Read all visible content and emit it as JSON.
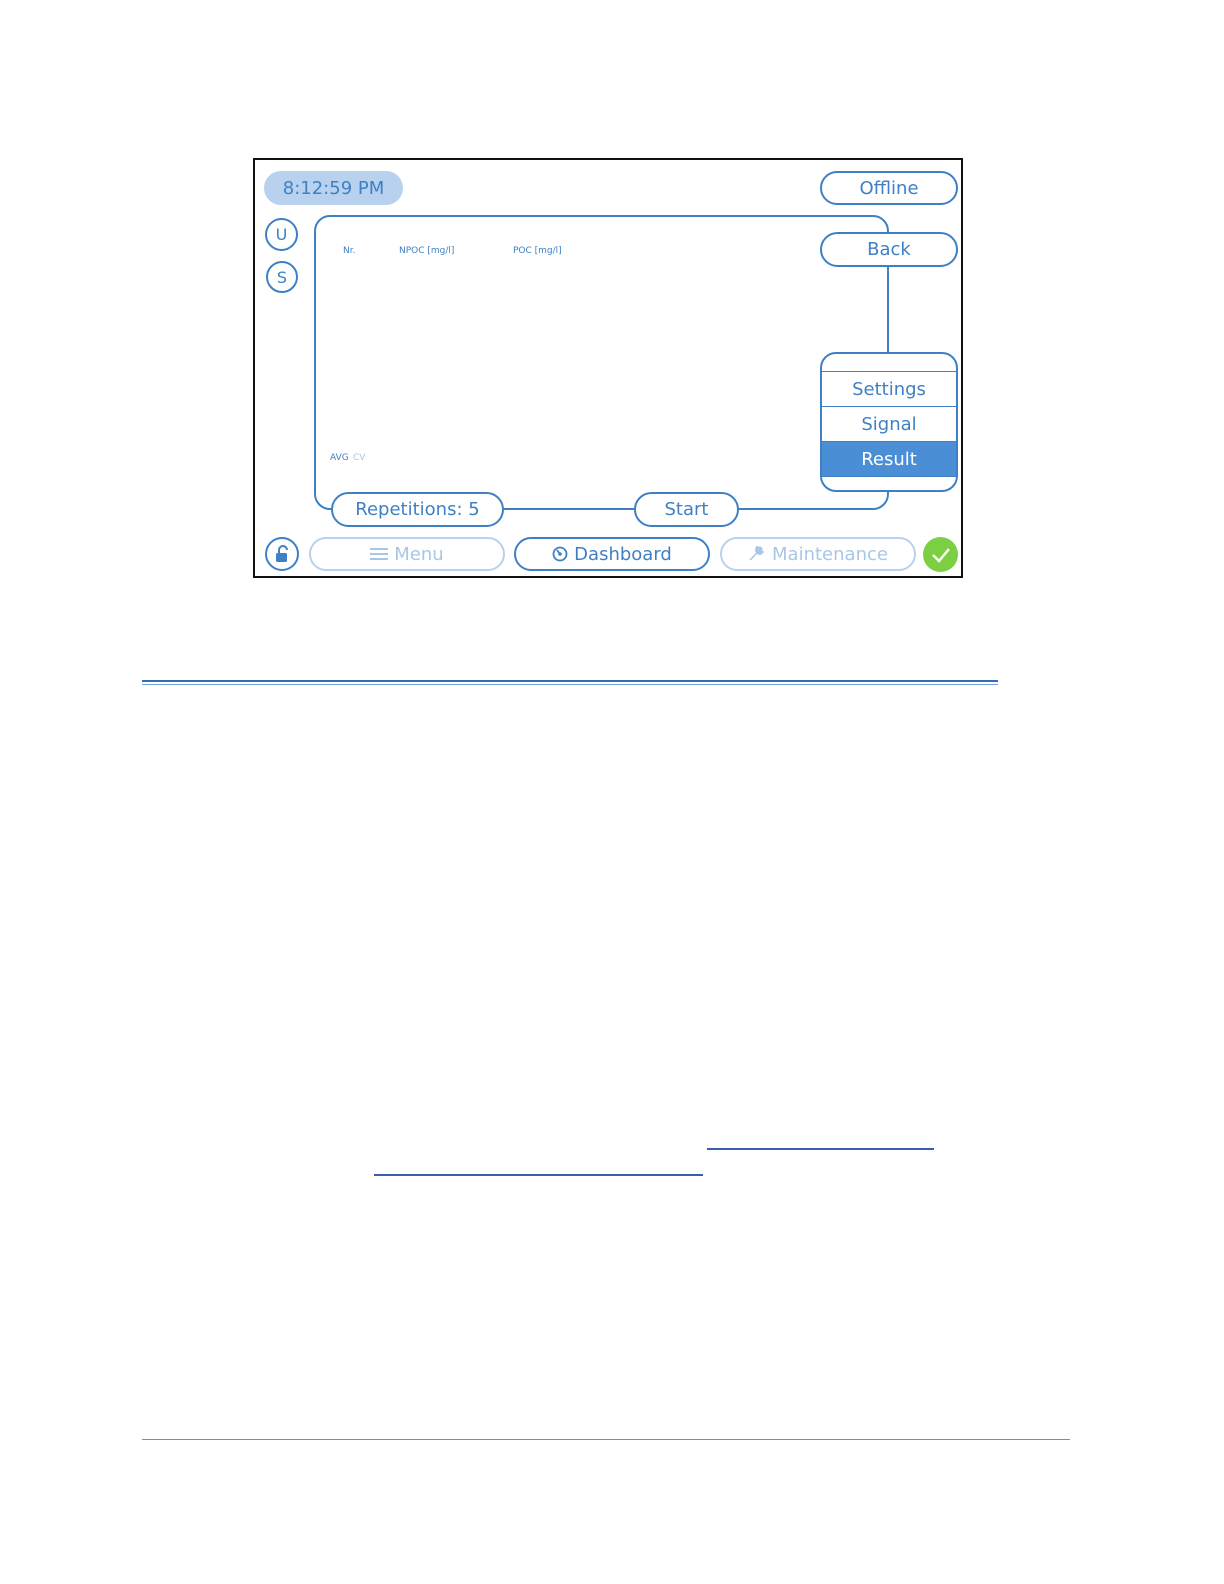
{
  "status": {
    "time": "8:12:59 PM",
    "connection": "Offline"
  },
  "side_buttons": {
    "u": "U",
    "s": "S"
  },
  "table": {
    "headers": [
      "Nr.",
      "NPOC [mg/l]",
      "POC [mg/l]"
    ],
    "footer_avg": "AVG",
    "footer_cv": "CV"
  },
  "right_panel": {
    "back": "Back",
    "tabs": [
      {
        "label": "Settings",
        "active": false
      },
      {
        "label": "Signal",
        "active": false
      },
      {
        "label": "Result",
        "active": true
      }
    ]
  },
  "controls": {
    "repetitions": "Repetitions: 5",
    "start": "Start"
  },
  "bottom_nav": {
    "menu": "Menu",
    "dashboard": "Dashboard",
    "maintenance": "Maintenance"
  },
  "icons": {
    "lock": "unlock-icon",
    "menu": "hamburger-icon",
    "dashboard": "gauge-icon",
    "maintenance": "wrench-icon",
    "status": "check-icon"
  },
  "colors": {
    "accent": "#3f80c4",
    "active_tab": "#4a8ed6",
    "time_bg": "#b7d1ee",
    "status_ok": "#7ccf43"
  }
}
